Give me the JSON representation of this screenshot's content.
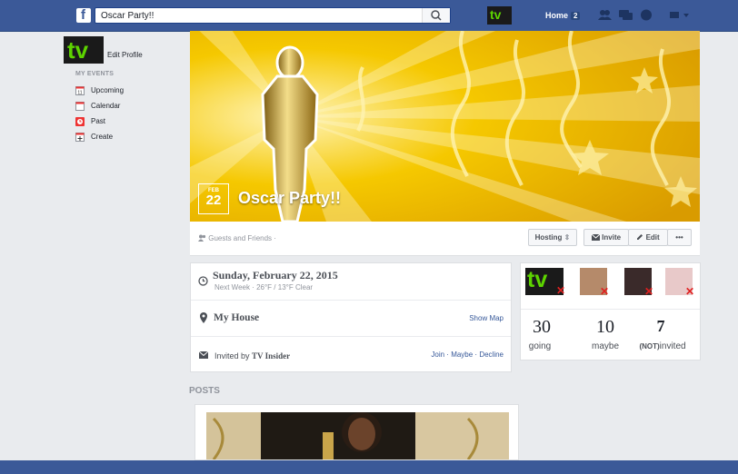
{
  "search": {
    "value": "Oscar Party!!"
  },
  "top_nav": {
    "avatar_text": "tv",
    "home_label": "Home",
    "home_count": "2"
  },
  "sidebar": {
    "avatar_text": "tv",
    "edit_profile": "Edit Profile",
    "section_title": "MY EVENTS",
    "items": [
      {
        "label": "Upcoming",
        "icon": "calendar-11-icon"
      },
      {
        "label": "Calendar",
        "icon": "calendar-icon"
      },
      {
        "label": "Past",
        "icon": "clock-icon"
      },
      {
        "label": "Create",
        "icon": "plus-calendar-icon"
      }
    ],
    "upcoming_icon_num": "11"
  },
  "event": {
    "month": "FEB",
    "day": "22",
    "title": "Oscar Party!!",
    "audience": "Guests and Friends ·",
    "hosting_label": "Hosting",
    "invite_label": "Invite",
    "edit_label": "Edit",
    "more_label": "•••",
    "date_full": "Sunday, February 22, 2015",
    "date_sub": "Next Week · 26°F / 13°F Clear",
    "location": "My House",
    "show_map": "Show Map",
    "invited_prefix": "Invited by",
    "invited_by": "TV Insider",
    "join_links": "Join · Maybe · Decline"
  },
  "guests": {
    "thumb_text": "tv",
    "stats": [
      {
        "count": "30",
        "label": "going"
      },
      {
        "count": "10",
        "label": "maybe"
      },
      {
        "count": "7",
        "label_prefix": "(NOT)",
        "label": "invited"
      }
    ]
  },
  "posts_title": "POSTS",
  "colors": {
    "brand": "#3b5998",
    "gold": "#e6a900",
    "link": "#365899",
    "tv_green": "#5dd400"
  }
}
